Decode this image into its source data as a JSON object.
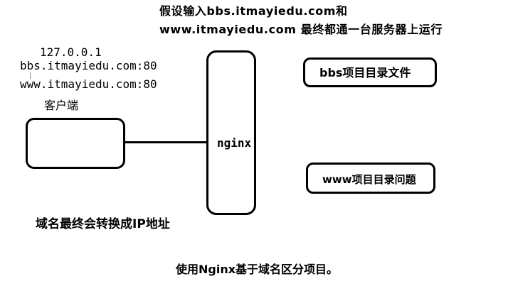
{
  "header": {
    "line1": "假设输入bbs.itmayiedu.com和",
    "line2": "www.itmayiedu.com 最终都通一台服务器上运行"
  },
  "client_info": {
    "ip": "127.0.0.1",
    "host1": "bbs.itmayiedu.com:80",
    "host2": "www.itmayiedu.com:80"
  },
  "nodes": {
    "client_label": "客户端",
    "nginx_label": "nginx",
    "bbs_label": "bbs项目目录文件",
    "www_label": "www项目目录问题"
  },
  "notes": {
    "resolve_note": "域名最终会转换成IP地址",
    "summary": "使用Nginx基于域名区分项目。"
  }
}
